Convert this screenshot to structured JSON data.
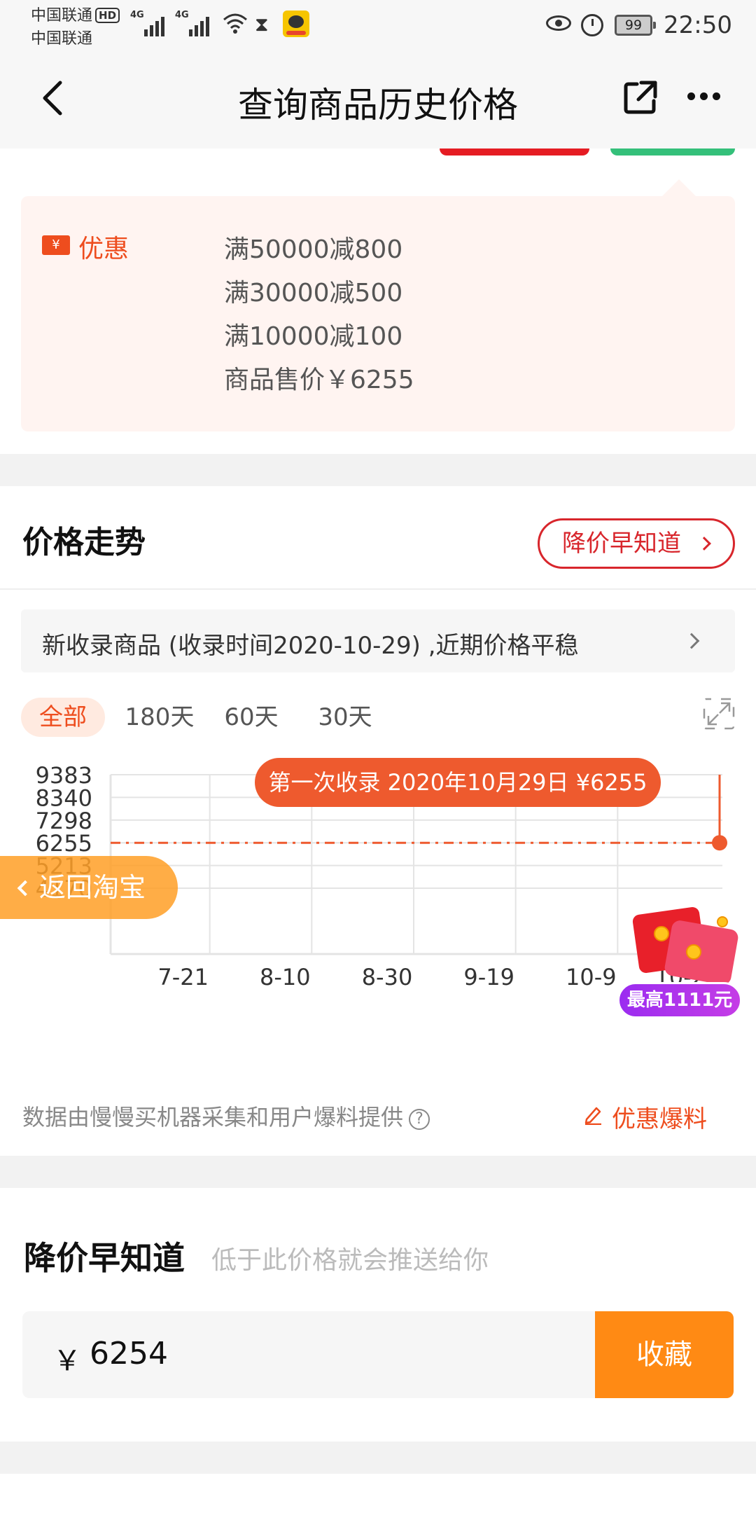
{
  "status_bar": {
    "carrier_1": "中国联通",
    "carrier_2": "中国联通",
    "hd": "HD",
    "network_1": "4G",
    "network_2": "4G",
    "battery": "99",
    "time": "22:50"
  },
  "nav": {
    "title": "查询商品历史价格",
    "icons": [
      "back-icon",
      "share-icon",
      "more-icon"
    ]
  },
  "promo": {
    "label": "优惠",
    "coupon_icon_text": "¥",
    "lines": [
      "满50000减800",
      "满30000减500",
      "满10000减100",
      "商品售价￥6255"
    ]
  },
  "trend": {
    "title": "价格走势",
    "notify_button": "降价早知道",
    "info_text": "新收录商品 (收录时间2020-10-29) ,近期价格平稳",
    "range_tabs": [
      "全部",
      "180天",
      "60天",
      "30天"
    ],
    "active_range": "全部",
    "first_record_label": "第一次收录 2020年10月29日 ¥6255",
    "return_button": "返回淘宝",
    "red_packet_badge": "最高1111元",
    "source_note": "数据由慢慢买机器采集和用户爆料提供",
    "report_link": "优惠爆料"
  },
  "chart_data": {
    "type": "line",
    "y_ticks": [
      "9383",
      "8340",
      "7298",
      "6255",
      "5213",
      "4170"
    ],
    "x_ticks": [
      "7-21",
      "8-10",
      "8-30",
      "9-19",
      "10-9",
      "10-29"
    ],
    "series": [
      {
        "x": [
          "10-29"
        ],
        "values": [
          6255
        ]
      }
    ],
    "ylim": [
      4170,
      9383
    ],
    "grid": true,
    "colors": {
      "line": "#ee5a2e",
      "grid": "#e4e4e4"
    }
  },
  "drop_notify": {
    "title": "降价早知道",
    "subtitle": "低于此价格就会推送给你",
    "currency": "￥",
    "price_value": "6254",
    "save_button": "收藏"
  }
}
